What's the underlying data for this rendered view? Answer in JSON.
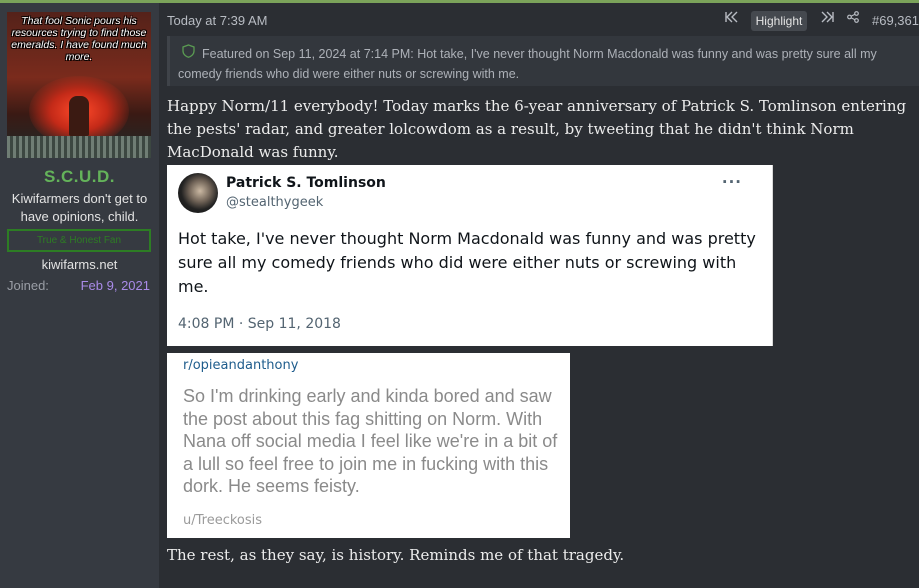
{
  "author": {
    "avatar_caption": "That fool Sonic pours his resources trying to find those emeralds. I have found much more.",
    "username": "S.C.U.D.",
    "user_title": "Kiwifarmers don't get to have opinions, child.",
    "user_banner": "True & Honest Fan",
    "website": "kiwifarms.net",
    "joined_label": "Joined:",
    "joined_date": "Feb 9, 2021"
  },
  "post": {
    "timestamp": "Today at 7:39 AM",
    "highlight_label": "Highlight",
    "number": "#69,361",
    "featured_text": "Featured on Sep 11, 2024 at 7:14 PM: Hot take, I've never thought Norm Macdonald was funny and was pretty sure all my comedy friends who did were either nuts or screwing with me.",
    "intro_text": "Happy Norm/11 everybody! Today marks the 6-year anniversary of Patrick S. Tomlinson entering the pests' radar, and greater lolcowdom as a result, by tweeting that he didn't think Norm MacDonald was funny.",
    "outro_text": "The rest, as they say, is history. Reminds me of that tragedy."
  },
  "tweet": {
    "display_name": "Patrick S. Tomlinson",
    "handle": "@stealthygeek",
    "more": "···",
    "text": "Hot take, I've never thought Norm Macdonald was funny and was pretty sure all my comedy friends who did were either nuts or screwing with me.",
    "time": "4:08 PM · Sep 11, 2018"
  },
  "reddit": {
    "subreddit": "r/opieandanthony",
    "text": "So I'm drinking early and kinda bored and saw the post about this fag shitting on Norm. With Nana off social media I feel like we're in a bit of a lull so feel free to join me in fucking with this dork. He seems feisty.",
    "user": "u/Treeckosis"
  },
  "icons": {
    "first": "⏮",
    "last": "⏭",
    "share": "share-icon",
    "featured": "shield-icon"
  },
  "colors": {
    "accent_green": "#64b35a",
    "joined_purple": "#a98be8",
    "background": "#2b2e33",
    "sidebar": "#363a41"
  }
}
